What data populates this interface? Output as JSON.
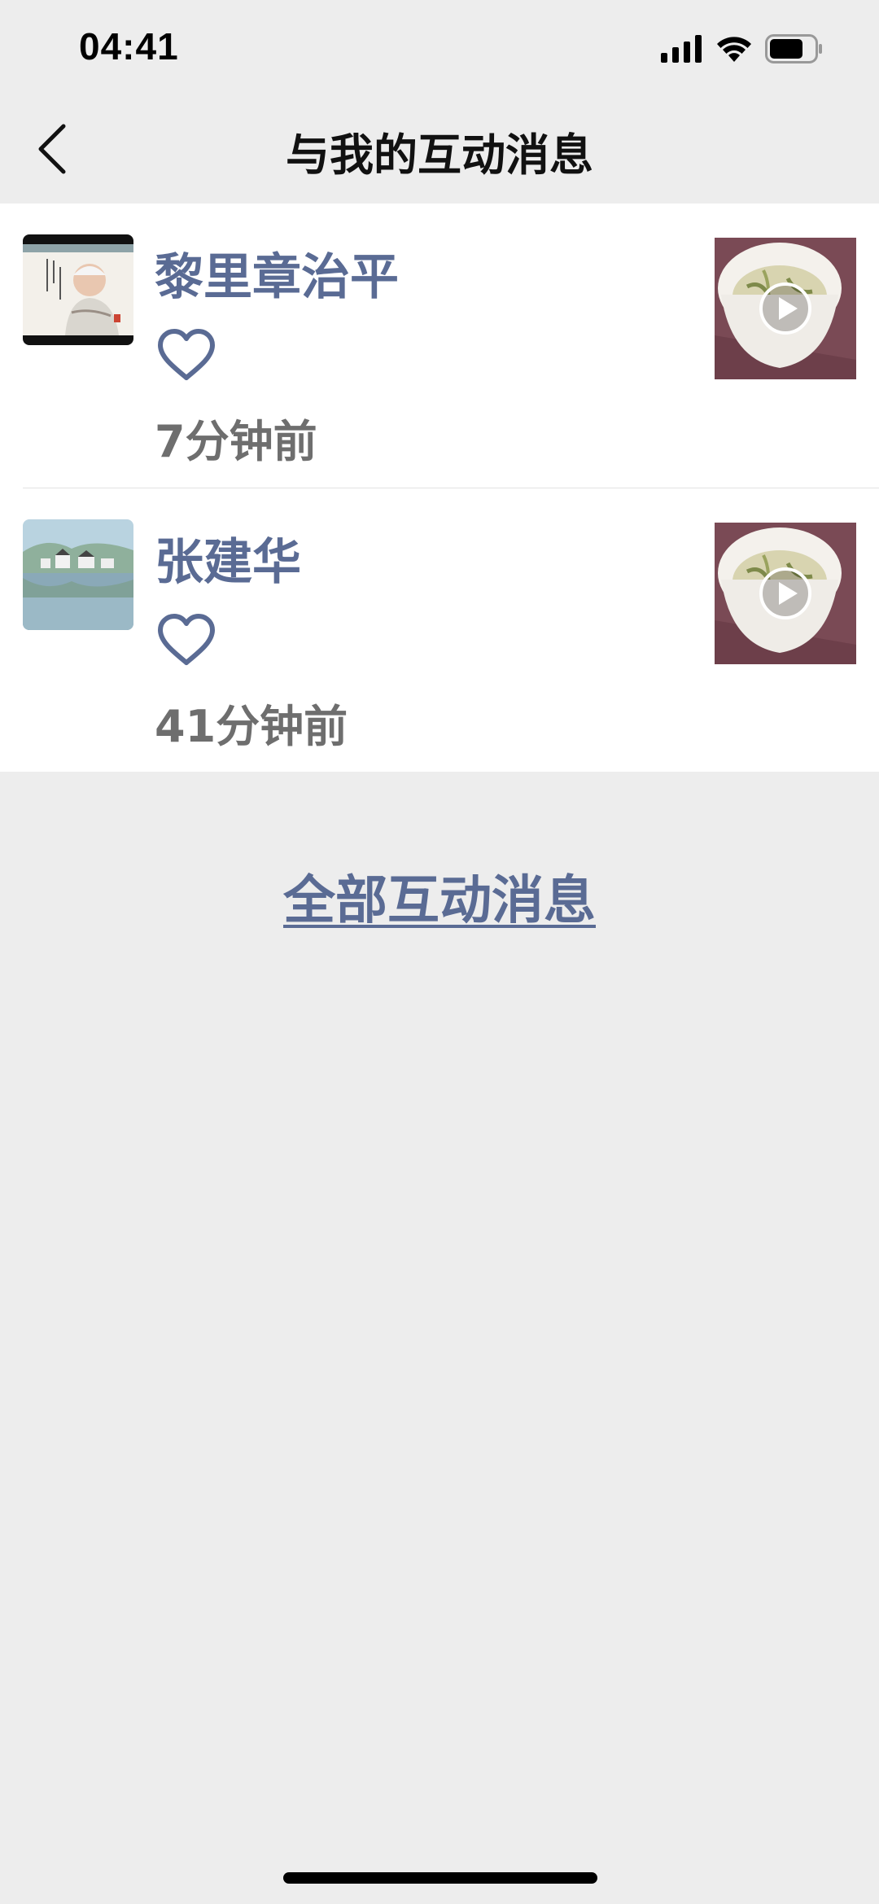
{
  "status_bar": {
    "time": "04:41",
    "icons": [
      "signal-icon",
      "wifi-icon",
      "battery-icon"
    ]
  },
  "nav": {
    "title": "与我的互动消息",
    "back_icon": "chevron-left-icon"
  },
  "messages": [
    {
      "name": "黎里章治平",
      "action_icon": "heart-icon",
      "time": "7分钟前",
      "avatar": "portrait-painting-avatar",
      "thumbnail": "tea-cup-video-thumbnail"
    },
    {
      "name": "张建华",
      "action_icon": "heart-icon",
      "time": "41分钟前",
      "avatar": "lake-village-avatar",
      "thumbnail": "tea-cup-video-thumbnail"
    }
  ],
  "footer": {
    "all_messages_label": "全部互动消息"
  },
  "colors": {
    "accent": "#5a6b94",
    "background": "#ededed",
    "list_background": "#ffffff",
    "secondary_text": "#6e6e6e"
  }
}
